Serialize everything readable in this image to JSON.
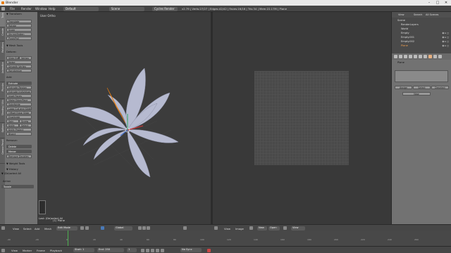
{
  "window": {
    "title": "Blender",
    "controls": [
      "–",
      "□",
      "✕"
    ]
  },
  "topbar": {
    "menus": [
      "File",
      "Render",
      "Window",
      "Help"
    ],
    "screen_layout": "Default",
    "scene": "Scene",
    "render_engine": "Cycles Render",
    "stats": "v2.79 | Verts:27/27 | Edges:42/42 | Faces:16/16 | Tris:34 | Mem:22.17M | Plane"
  },
  "left_tabs": [
    "Tools",
    "Create",
    "Relations",
    "Animation",
    "Physics",
    "Shading / UVs",
    "Options",
    "Grease Pencil"
  ],
  "tool_panel": {
    "transform_head": "▼ Transform",
    "transform": [
      "Translate",
      "Rotate",
      "Scale",
      "Shrink/Fatten",
      "Push/Pull"
    ],
    "mesh_tools_head": "▼ Mesh Tools",
    "deform_head": "Deform:",
    "deform": [
      "Slide Edge",
      "Vertex",
      "Noise",
      "Smooth Vertex",
      "Randomize"
    ],
    "add_head": "Add:",
    "extrude": "Extrude",
    "add": [
      "Extrude Region",
      "Extrude Individual",
      "Inset Faces",
      "Make Edge/Face",
      "Subdivide",
      "Loop Cut and Slide",
      "Offset Edge Slide",
      "Duplicate"
    ],
    "spin": "Spin",
    "screw": "Screw",
    "knife": "Knife",
    "select": "Select",
    "knife_project": "Knife Project",
    "bisect": "Bisect",
    "remove_head": "Remove:",
    "delete": "Delete",
    "merge": "Merge",
    "remove_doubles": "Remove Doubles",
    "weight_tools_head": "▼ Weight Tools",
    "history_head": "▼ History",
    "last_op_head": "▼ (De)select All",
    "action_label": "Action",
    "action_value": "Toggle"
  },
  "viewport": {
    "label": "User Ortho",
    "object": "(1) Plane",
    "last_op": "Last: (De)select All"
  },
  "outliner": {
    "header_items": [
      "View",
      "Search",
      "All Scenes"
    ],
    "items": [
      "Scene",
      "RenderLayers",
      "World",
      "Empty",
      "Empty.001",
      "Empty.002",
      "Plane"
    ]
  },
  "properties": {
    "object_name": "Plane",
    "buttons": [
      "Assign",
      "Select",
      "Deselect"
    ],
    "new_label": "New"
  },
  "viewport_header": {
    "items": [
      "View",
      "Select",
      "Add",
      "Mesh"
    ],
    "mode": "Edit Mode",
    "pivot": "Global"
  },
  "uv_header": {
    "items": [
      "View",
      "Image"
    ],
    "new": "New",
    "open": "Open",
    "view": "View"
  },
  "timeline": {
    "ticks": [
      "-40",
      "-20",
      "0",
      "20",
      "40",
      "60",
      "80",
      "100",
      "120",
      "140",
      "160",
      "180",
      "200",
      "220",
      "240",
      "260"
    ]
  },
  "time_header": {
    "items": [
      "View",
      "Marker",
      "Frame",
      "Playback"
    ],
    "start": "Start:",
    "start_val": "1",
    "end": "End:",
    "end_val": "250",
    "current": "1",
    "sync": "No Sync"
  },
  "colors": {
    "accent_orange": "#e87d0d",
    "timeline_cursor": "#4caf50",
    "flower": "#b6bad0"
  }
}
